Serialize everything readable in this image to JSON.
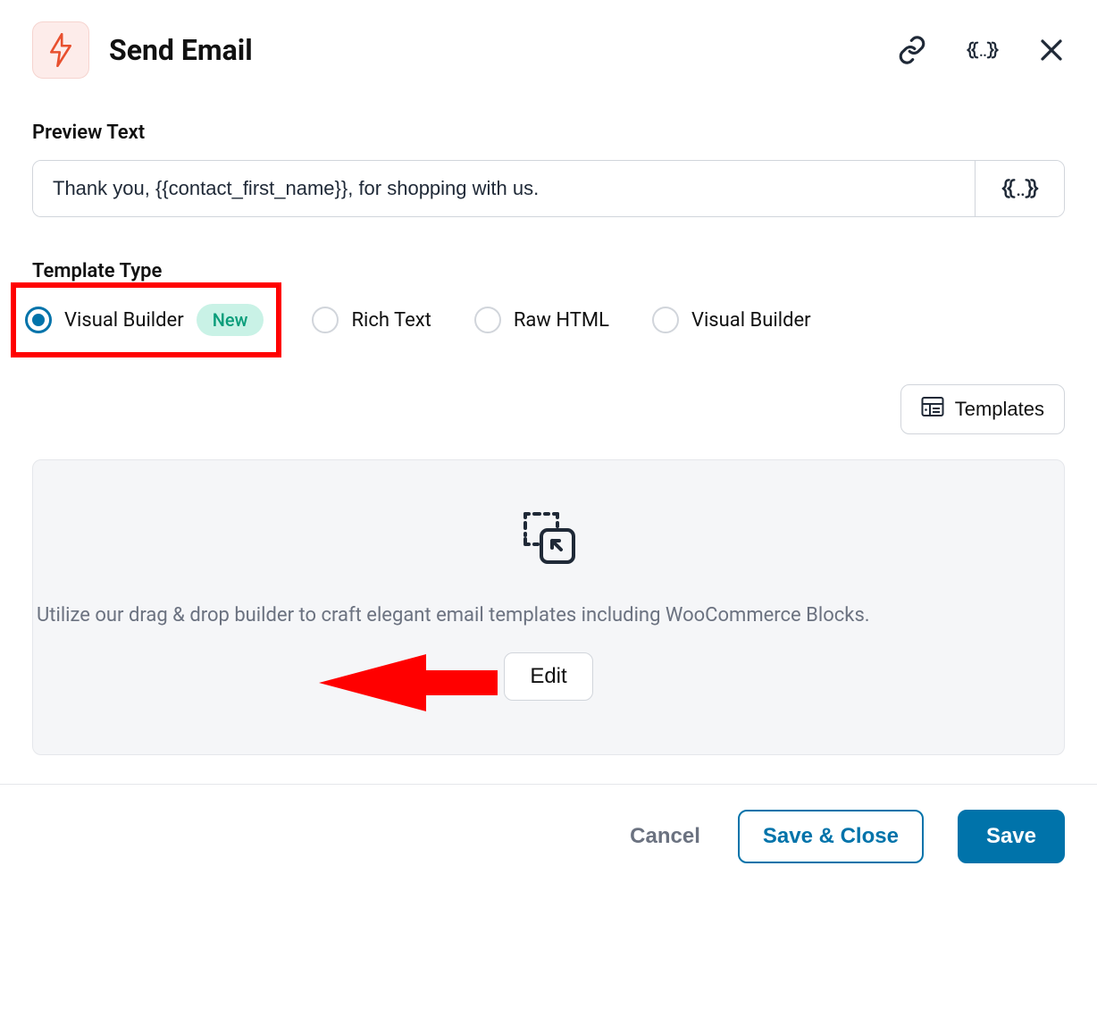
{
  "header": {
    "title": "Send Email"
  },
  "preview": {
    "label": "Preview Text",
    "value": "Thank you, {{contact_first_name}}, for shopping with us."
  },
  "template_type": {
    "label": "Template Type",
    "options": [
      {
        "label": "Visual Builder",
        "selected": true,
        "badge": "New"
      },
      {
        "label": "Rich Text",
        "selected": false
      },
      {
        "label": "Raw HTML",
        "selected": false
      },
      {
        "label": "Visual Builder",
        "selected": false
      }
    ]
  },
  "templates_button": "Templates",
  "panel": {
    "description": "Utilize our drag & drop builder to craft elegant email templates including WooCommerce Blocks.",
    "edit_label": "Edit"
  },
  "footer": {
    "cancel": "Cancel",
    "save_close": "Save & Close",
    "save": "Save"
  }
}
